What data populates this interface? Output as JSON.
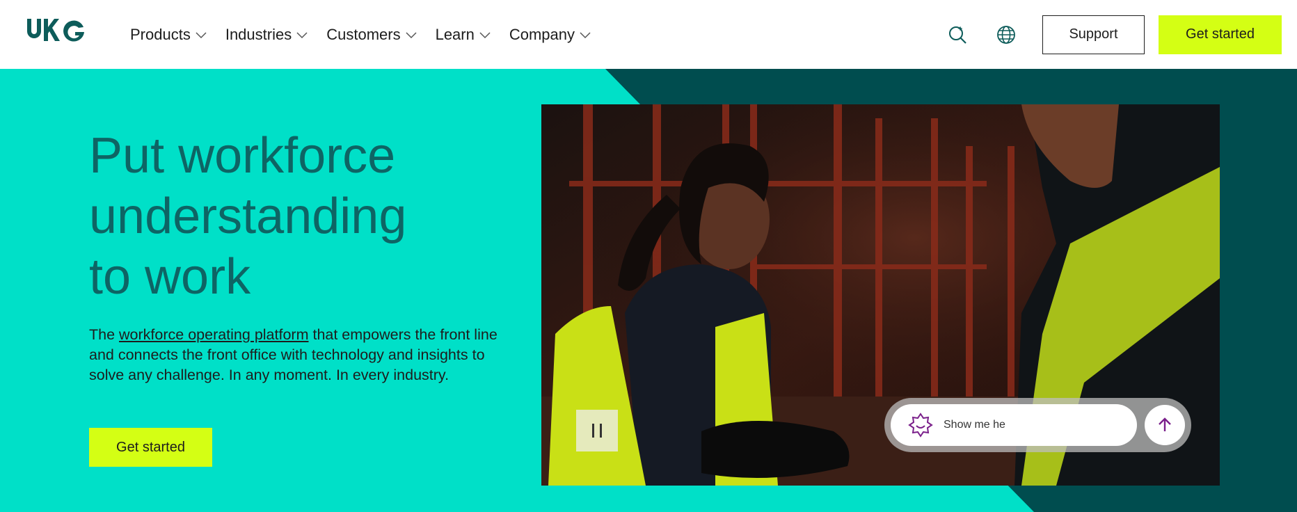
{
  "brand": {
    "logo_text": "UKG"
  },
  "nav": {
    "items": [
      {
        "label": "Products"
      },
      {
        "label": "Industries"
      },
      {
        "label": "Customers"
      },
      {
        "label": "Learn"
      },
      {
        "label": "Company"
      }
    ]
  },
  "header": {
    "support_label": "Support",
    "get_started_label": "Get started"
  },
  "hero": {
    "title_lines": [
      "Put workforce",
      "understanding",
      "to work"
    ],
    "desc_before": "The ",
    "desc_link": "workforce operating platform",
    "desc_after": " that empowers the front line and connects the front office with technology and insights to solve any challenge. In any moment. In every industry.",
    "cta_label": "Get started"
  },
  "chat": {
    "input_text": "Show me he"
  },
  "colors": {
    "teal": "#00e0c8",
    "dark_teal": "#004d4f",
    "lime": "#d4ff14",
    "heading": "#0e6464",
    "chat_accent": "#7a1f8a"
  },
  "icons": {
    "search": "search-icon",
    "globe": "globe-icon",
    "pause": "pause-icon",
    "chat": "sparkle-face-icon",
    "send": "arrow-up-icon"
  }
}
